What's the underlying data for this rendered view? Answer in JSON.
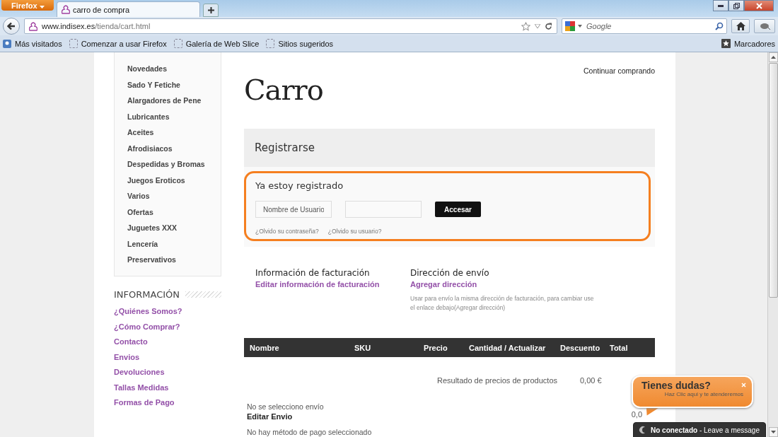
{
  "browser": {
    "menu_button": "Firefox",
    "tabs": [
      {
        "title": "carro de compra",
        "selected": true
      }
    ],
    "url": {
      "domain": "www.indisex.es",
      "path": "/tienda/cart.html"
    },
    "search": {
      "placeholder": "Google"
    },
    "bookmarks": [
      "Más visitados",
      "Comenzar a usar Firefox",
      "Galería de Web Slice",
      "Sitios sugeridos"
    ],
    "bookmarks_menu": "Marcadores"
  },
  "sidebar": {
    "categories": [
      "Novedades",
      "Sado Y Fetiche",
      "Alargadores de Pene",
      "Lubricantes",
      "Aceites",
      "Afrodisiacos",
      "Despedidas y Bromas",
      "Juegos Eroticos",
      "Varios",
      "Ofertas",
      "Juguetes XXX",
      "Lencería",
      "Preservativos"
    ],
    "info_title": "INFORMACIÓN",
    "info_links": [
      "¿Quiénes Somos?",
      "¿Cómo Comprar?",
      "Contacto",
      "Envios",
      "Devoluciones",
      "Tallas Medidas",
      "Formas de Pago"
    ]
  },
  "main": {
    "continue_link": "Continuar comprando",
    "title": "Carro",
    "register_title": "Registrarse",
    "login": {
      "title": "Ya estoy registrado",
      "username_placeholder": "Nombre de Usuario",
      "submit": "Accesar",
      "forgot_password": "¿Olvido su contraseña?",
      "forgot_user": "¿Olvido su usuario?"
    },
    "billing": {
      "title": "Información de facturación",
      "link": "Editar información de facturación"
    },
    "shipping": {
      "title": "Dirección de envío",
      "link": "Agregar dirección",
      "note": "Usar para envío la misma dirección de facturación, para cambiar use el enlace debajo(Agregar dirección)"
    },
    "table": {
      "columns": [
        "Nombre",
        "SKU",
        "Precio",
        "Cantidad / Actualizar",
        "Descuento",
        "Total"
      ]
    },
    "subtotal_label": "Resultado de precios de productos",
    "subtotal_value": "0,00 €",
    "total_value": "0,0",
    "shipping_status": "No se selecciono envío",
    "edit_shipping": "Editar Envio",
    "payment_status": "No hay método de pago seleccionado"
  },
  "chat": {
    "title": "Tienes dudas?",
    "subtitle": "Haz Clic aqui y te atenderemos",
    "status": "No conectado",
    "status_note": " - Leave a message"
  }
}
